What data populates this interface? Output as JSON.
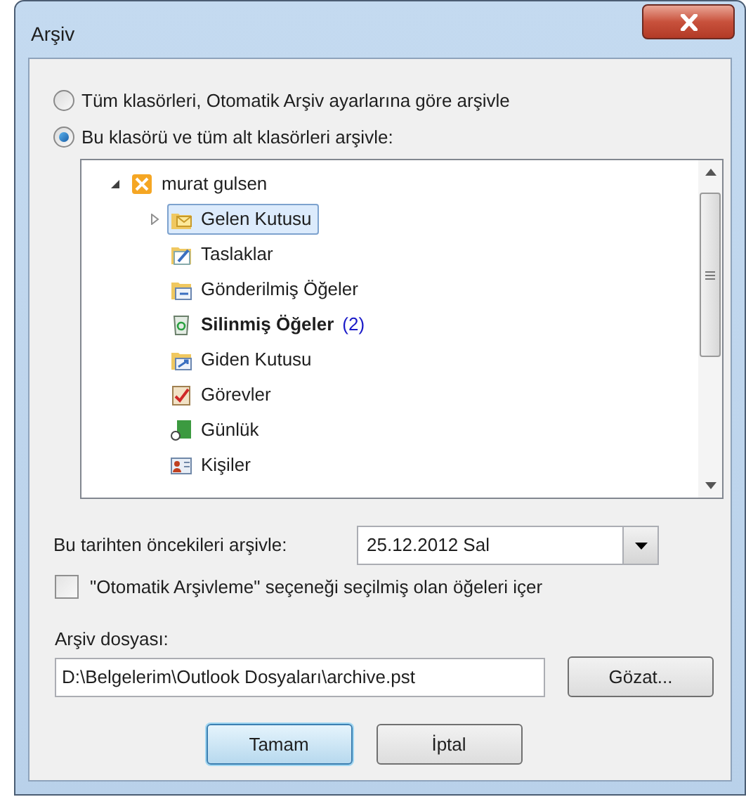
{
  "window": {
    "title": "Arşiv"
  },
  "options": [
    {
      "label": "Tüm klasörleri, Otomatik Arşiv ayarlarına göre arşivle",
      "selected": false
    },
    {
      "label": "Bu klasörü ve tüm alt klasörleri arşivle:",
      "selected": true
    }
  ],
  "tree": {
    "label": "murat gulsen",
    "kind": "mailbox",
    "expanded": true,
    "children": [
      {
        "label": "Gelen Kutusu",
        "kind": "inbox",
        "expanded": false,
        "selected": true
      },
      {
        "label": "Taslaklar",
        "kind": "drafts",
        "selected": false
      },
      {
        "label": "Gönderilmiş Öğeler",
        "kind": "sent",
        "selected": false
      },
      {
        "label": "Silinmiş Öğeler",
        "kind": "deleted",
        "count": "(2)",
        "selected": false
      },
      {
        "label": "Giden Kutusu",
        "kind": "outbox",
        "selected": false
      },
      {
        "label": "Görevler",
        "kind": "tasks",
        "selected": false
      },
      {
        "label": "Günlük",
        "kind": "journal",
        "selected": false
      },
      {
        "label": "Kişiler",
        "kind": "contacts",
        "selected": false
      }
    ]
  },
  "date": {
    "label": "Bu tarihten öncekileri arşivle:",
    "value": "25.12.2012 Sal"
  },
  "include_checkbox": {
    "label": "\"Otomatik Arşivleme\" seçeneği seçilmiş olan öğeleri içer",
    "checked": false
  },
  "archive_file": {
    "label": "Arşiv dosyası:",
    "value": "D:\\Belgelerim\\Outlook Dosyaları\\archive.pst",
    "browse": "Gözat..."
  },
  "buttons": [
    {
      "label": "Tamam",
      "kind": "default"
    },
    {
      "label": "İptal",
      "kind": "normal"
    }
  ]
}
